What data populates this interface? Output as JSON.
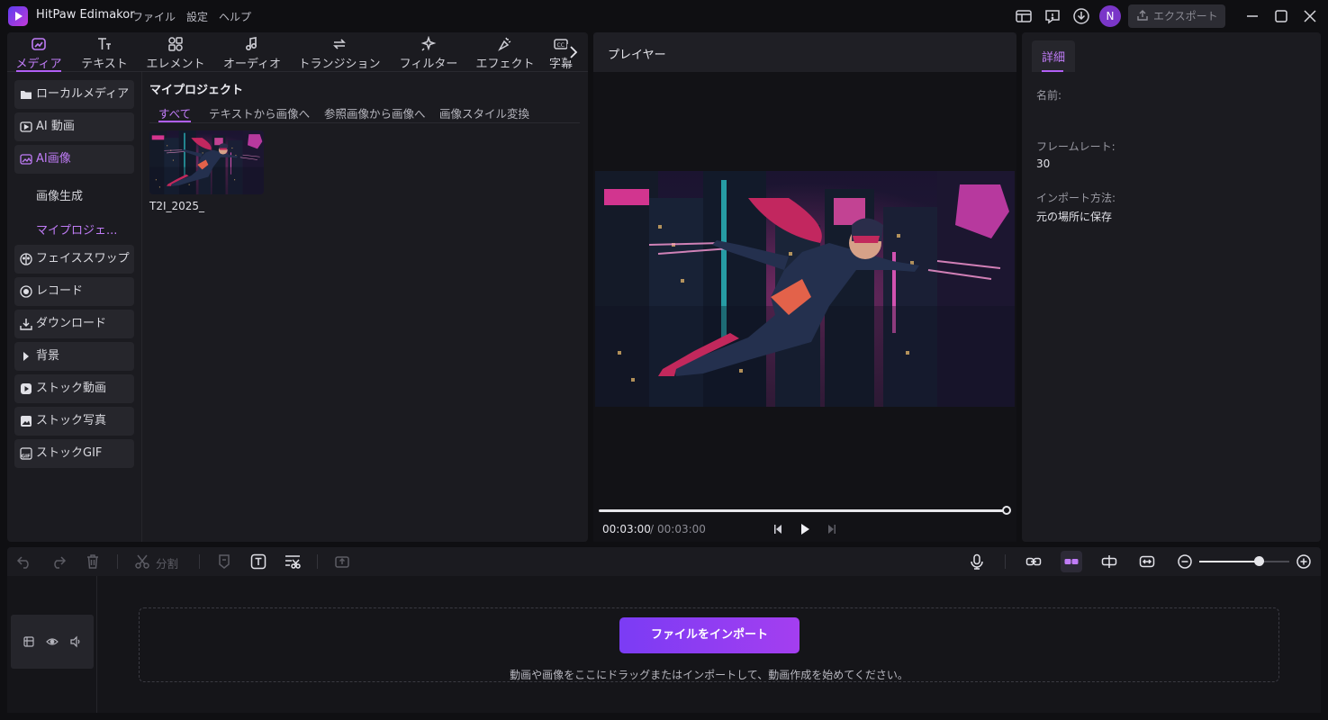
{
  "app": {
    "title": "HitPaw Edimakor",
    "avatar_initial": "N"
  },
  "menu": [
    "ファイル",
    "設定",
    "ヘルプ"
  ],
  "header": {
    "export_label": "エクスポート"
  },
  "toolbar_tabs": [
    {
      "label": "メディア",
      "icon": "media-icon",
      "active": true
    },
    {
      "label": "テキスト",
      "icon": "text-icon"
    },
    {
      "label": "エレメント",
      "icon": "element-icon"
    },
    {
      "label": "オーディオ",
      "icon": "audio-icon"
    },
    {
      "label": "トランジション",
      "icon": "transition-icon"
    },
    {
      "label": "フィルター",
      "icon": "filter-icon"
    },
    {
      "label": "エフェクト",
      "icon": "effect-icon"
    },
    {
      "label": "字幕",
      "icon": "subtitle-icon"
    }
  ],
  "sidebar": {
    "items": [
      {
        "label": "ローカルメディア",
        "icon": "folder-icon"
      },
      {
        "label": "AI 動画",
        "icon": "ai-video-icon"
      },
      {
        "label": "AI画像",
        "icon": "ai-image-icon",
        "active": true
      },
      {
        "label": "画像生成"
      },
      {
        "label": "マイプロジェ...",
        "active": true
      },
      {
        "label": "フェイススワップ",
        "icon": "face-swap-icon"
      },
      {
        "label": "レコード",
        "icon": "record-icon"
      },
      {
        "label": "ダウンロード",
        "icon": "download-icon"
      },
      {
        "label": "背景",
        "icon": "caret-right-icon"
      },
      {
        "label": "ストック動画",
        "icon": "stock-video-icon"
      },
      {
        "label": "ストック写真",
        "icon": "stock-photo-icon"
      },
      {
        "label": "ストックGIF",
        "icon": "gif-icon"
      }
    ]
  },
  "project": {
    "title": "マイプロジェクト",
    "tabs": [
      "すべて",
      "テキストから画像へ",
      "参照画像から画像へ",
      "画像スタイル変換"
    ],
    "items": [
      {
        "name": "T2I_2025_"
      }
    ]
  },
  "player": {
    "title": "プレイヤー",
    "current_time": "00:03:00",
    "separator": "/",
    "total_time": "00:03:00",
    "progress": 1.0
  },
  "details": {
    "tab": "詳細",
    "name_label": "名前:",
    "name_value": "",
    "framerate_label": "フレームレート:",
    "framerate_value": "30",
    "import_label": "インポート方法:",
    "import_value": "元の場所に保存"
  },
  "timeline": {
    "split_label": "分割",
    "zoom_level": 0.66,
    "import_button": "ファイルをインポート",
    "hint": "動画や画像をここにドラッグまたはインポートして、動画作成を始めてください。"
  },
  "colors": {
    "accent": "#b15ff5",
    "accent_text": "#c07cf7",
    "background": "#0f0f12",
    "panel": "#1b1b20"
  }
}
